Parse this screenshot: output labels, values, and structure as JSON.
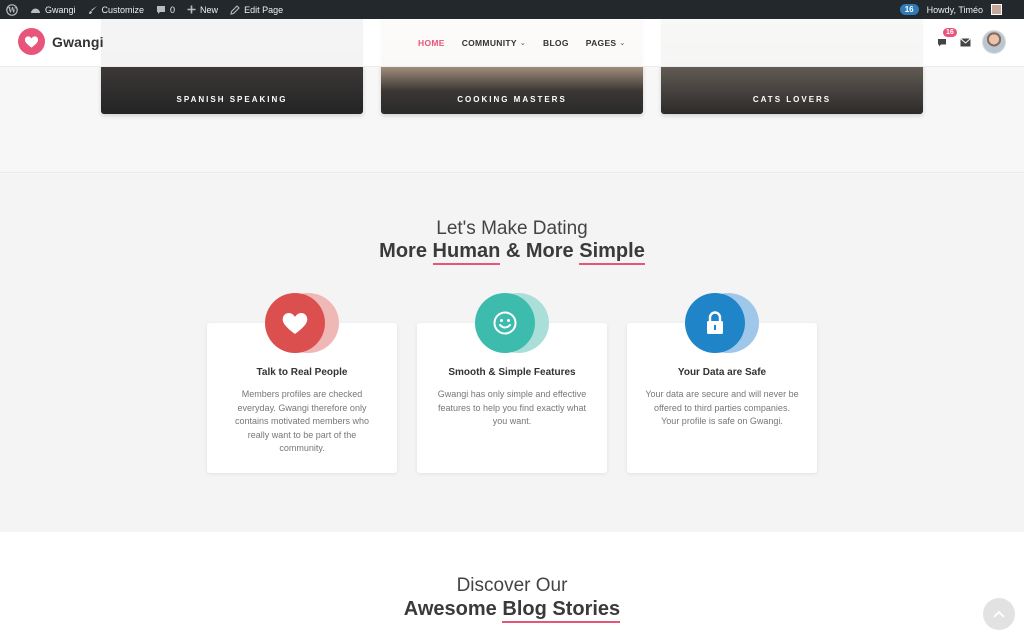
{
  "adminbar": {
    "site_name": "Gwangi",
    "customize": "Customize",
    "comments_count": "0",
    "new_label": "New",
    "edit_page": "Edit Page",
    "updates_count": "16",
    "howdy": "Howdy, Timéo"
  },
  "header": {
    "logo_text": "Gwangi",
    "nav": [
      {
        "label": "HOME",
        "active": true
      },
      {
        "label": "COMMUNITY",
        "dropdown": true
      },
      {
        "label": "BLOG"
      },
      {
        "label": "PAGES",
        "dropdown": true
      }
    ],
    "notifications_count": "16"
  },
  "groups": [
    {
      "label": "SPANISH SPEAKING"
    },
    {
      "label": "COOKING MASTERS"
    },
    {
      "label": "CATS LOVERS"
    }
  ],
  "features": {
    "title_line1": "Let's Make Dating",
    "title_more1": "More",
    "title_human": "Human",
    "title_amp": "& More",
    "title_simple": "Simple",
    "cards": [
      {
        "icon": "heart-icon",
        "color": "#dc4f4f",
        "title": "Talk to Real People",
        "desc": "Members profiles are checked everyday. Gwangi therefore only contains motivated members who really want to be part of the community."
      },
      {
        "icon": "smiley-icon",
        "color": "#3dbcae",
        "title": "Smooth & Simple Features",
        "desc": "Gwangi has only simple and effective features to help you find exactly what you want."
      },
      {
        "icon": "lock-icon",
        "color": "#1f84c8",
        "title": "Your Data are Safe",
        "desc": "Your data are secure and will never be offered to third parties companies. Your profile is safe on Gwangi."
      }
    ]
  },
  "blog": {
    "title_line1": "Discover Our",
    "title_awesome": "Awesome",
    "title_blog": "Blog",
    "title_stories": "Stories"
  },
  "colors": {
    "accent": "#e8557a",
    "adminbar": "#23282d"
  }
}
